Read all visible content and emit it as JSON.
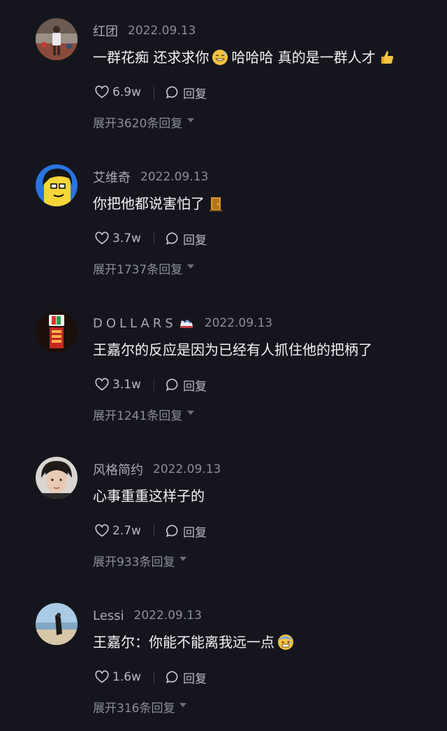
{
  "comments": [
    {
      "username": "红团",
      "date": "2022.09.13",
      "text_a": "一群花痴 还求求你",
      "text_b": "哈哈哈 真的是一群人才",
      "likes": "6.9w",
      "reply_label": "回复",
      "expand_label": "展开3620条回复",
      "emojis": [
        "grinning-sweat-emoji",
        "thumbs-up-emoji"
      ]
    },
    {
      "username": "艾维奇",
      "date": "2022.09.13",
      "text_a": "你把他都说害怕了",
      "likes": "3.7w",
      "reply_label": "回复",
      "expand_label": "展开1737条回复",
      "emojis": [
        "door-emoji"
      ]
    },
    {
      "username": "DOLLARS",
      "date": "2022.09.13",
      "text_a": "王嘉尔的反应是因为已经有人抓住他的把柄了",
      "likes": "3.1w",
      "reply_label": "回复",
      "expand_label": "展开1241条回复",
      "emojis": [
        "sneaker-emoji"
      ]
    },
    {
      "username": "风格简约",
      "date": "2022.09.13",
      "text_a": "心事重重这样子的",
      "likes": "2.7w",
      "reply_label": "回复",
      "expand_label": "展开933条回复"
    },
    {
      "username": "Lessi",
      "date": "2022.09.13",
      "text_a": "王嘉尔：你能不能离我远一点",
      "likes": "1.6w",
      "reply_label": "回复",
      "expand_label": "展开316条回复",
      "emojis": [
        "anxious-sweat-emoji"
      ]
    }
  ],
  "colors": {
    "background": "#15161d",
    "username": "#a9aab1",
    "text": "#f2f2f4",
    "secondary": "#8c8d95"
  }
}
